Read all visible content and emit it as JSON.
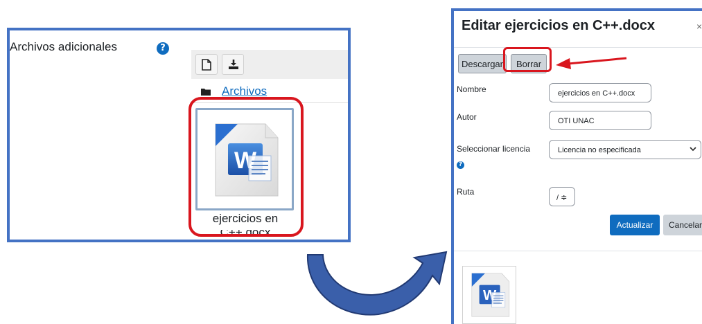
{
  "left_panel": {
    "label": "Archivos adicionales",
    "help": "?",
    "toolbar": {
      "add_file_icon": "file-icon",
      "download_icon": "download-icon"
    },
    "path": {
      "folder_icon": "folder-icon",
      "label": "Archivos"
    },
    "file": {
      "icon": "word-document-icon",
      "name": "ejercicios en",
      "name_cont": "C++.docx"
    }
  },
  "dialog": {
    "title": "Editar ejercicios en C++.docx",
    "close": "×",
    "buttons": {
      "download": "Descargar",
      "delete": "Borrar"
    },
    "fields": {
      "name_label": "Nombre",
      "name_value": "ejercicios en C++.docx",
      "author_label": "Autor",
      "author_value": "OTI UNAC",
      "license_label": "Seleccionar licencia",
      "license_value": "Licencia no especificada",
      "license_help": "?",
      "path_label": "Ruta",
      "path_value": "/ ≑"
    },
    "actions": {
      "update": "Actualizar",
      "cancel": "Cancelar"
    },
    "preview_icon": "word-document-icon"
  },
  "annotations": {
    "highlight_color": "#d9161e",
    "frame_color": "#4472c4",
    "accent": "#0f6cbf"
  }
}
